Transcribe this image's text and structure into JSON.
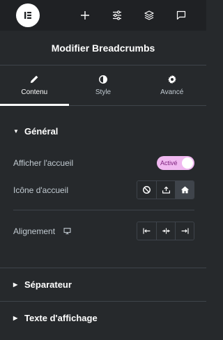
{
  "topbar": {
    "icons": [
      "elementor-logo-icon",
      "plus-icon",
      "sliders-icon",
      "layers-icon",
      "chat-icon"
    ]
  },
  "header": {
    "title": "Modifier Breadcrumbs"
  },
  "tabs": [
    {
      "label": "Contenu",
      "icon": "pencil-icon",
      "active": true
    },
    {
      "label": "Style",
      "icon": "contrast-icon",
      "active": false
    },
    {
      "label": "Avancé",
      "icon": "gear-icon",
      "active": false
    }
  ],
  "general": {
    "title": "Général",
    "show_home_label": "Afficher l'accueil",
    "toggle_label": "Activé",
    "home_icon_label": "Icône d'accueil",
    "home_icon_options": [
      "none-icon",
      "upload-icon",
      "home-icon"
    ],
    "home_icon_selected": 2,
    "alignment_label": "Alignement",
    "alignment_options": [
      "align-left-icon",
      "align-center-icon",
      "align-right-icon"
    ]
  },
  "separator": {
    "title": "Séparateur"
  },
  "display_text": {
    "title": "Texte d'affichage"
  },
  "colors": {
    "background": "#26292c",
    "topbar": "#1f2124",
    "border": "#3f444b",
    "toggle_bg": "#f0b8f0"
  }
}
